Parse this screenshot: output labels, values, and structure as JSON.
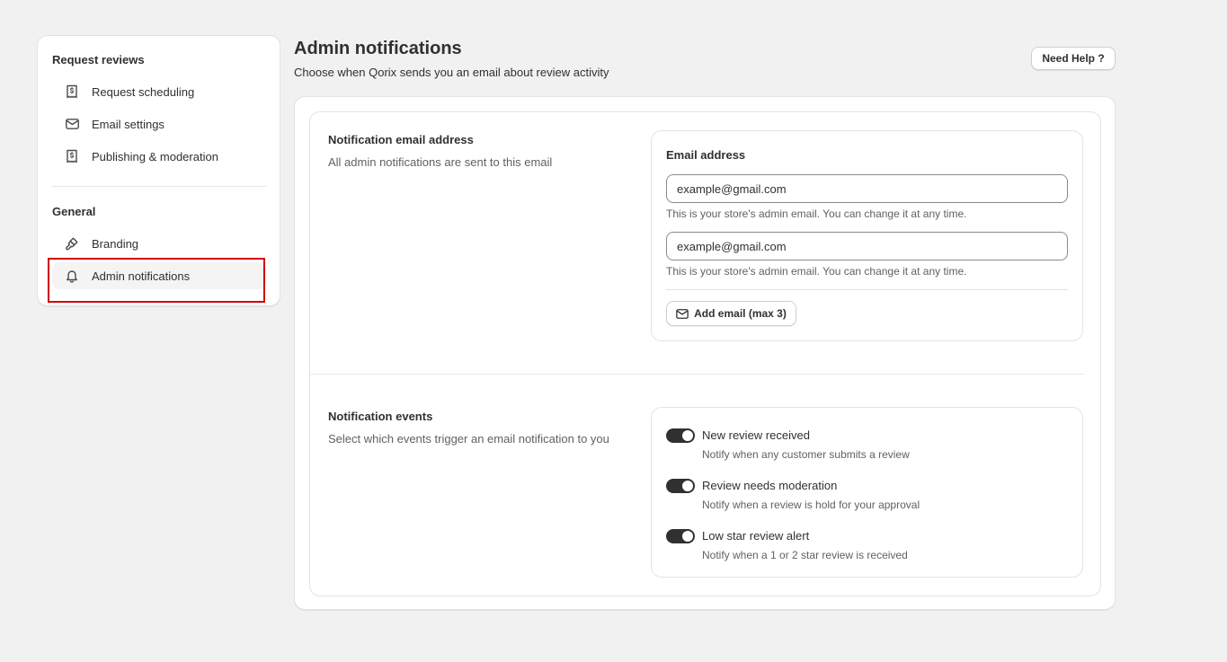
{
  "sidebar": {
    "section1_title": "Request reviews",
    "items1": [
      {
        "label": "Request scheduling",
        "icon": "receipt-icon"
      },
      {
        "label": "Email settings",
        "icon": "envelope-icon"
      },
      {
        "label": "Publishing & moderation",
        "icon": "receipt-icon"
      }
    ],
    "section2_title": "General",
    "items2": [
      {
        "label": "Branding",
        "icon": "paint-brush-icon"
      },
      {
        "label": "Admin notifications",
        "icon": "bell-icon"
      }
    ]
  },
  "header": {
    "title": "Admin notifications",
    "subtitle": "Choose when Qorix sends you an email about review activity",
    "help_label": "Need Help ?"
  },
  "email_section": {
    "title": "Notification email address",
    "description": "All admin notifications are sent to this email",
    "field_label": "Email address",
    "emails": [
      {
        "value": "example@gmail.com",
        "help": "This is your store's admin email. You can change it at any time."
      },
      {
        "value": "example@gmail.com",
        "help": "This is your store's admin email. You can change it at any time."
      }
    ],
    "add_label": "Add email (max 3)"
  },
  "events_section": {
    "title": "Notification events",
    "description": "Select which events trigger an email notification to you",
    "events": [
      {
        "title": "New review received",
        "description": "Notify when any customer submits a review",
        "enabled": true
      },
      {
        "title": "Review needs moderation",
        "description": "Notify when a review is hold for your approval",
        "enabled": true
      },
      {
        "title": "Low star review alert",
        "description": "Notify when a 1 or 2 star review is received",
        "enabled": true
      }
    ]
  },
  "colors": {
    "background": "#f1f1f1",
    "highlight": "#d20000",
    "toggle_on": "#303030"
  }
}
